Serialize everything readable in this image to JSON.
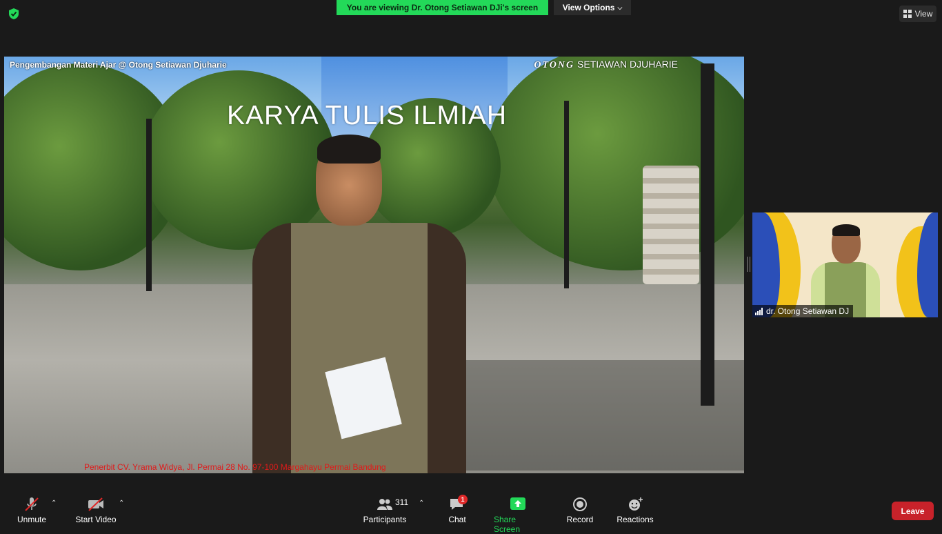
{
  "header": {
    "banner_text": "You are viewing Dr. Otong Setiawan DJi's screen",
    "view_options_label": "View Options",
    "view_label": "View",
    "security_icon": "shield-check-icon"
  },
  "shared_screen": {
    "header_text": "Pengembangan Materi Ajar  @ Otong Setiawan Djuharie",
    "brand_name": "OTONG",
    "brand_surname": "SETIAWAN DJUHARIE",
    "title": "KARYA TULIS ILMIAH",
    "footer_text": "Penerbit CV. Yrama Widya, Jl. Permai 28 No. 97-100 Margahayu Permai Bandung"
  },
  "participant_tile": {
    "name": "dr. Otong Setiawan DJ"
  },
  "toolbar": {
    "unmute_label": "Unmute",
    "start_video_label": "Start Video",
    "participants_label": "Participants",
    "participants_count": "311",
    "chat_label": "Chat",
    "chat_badge": "1",
    "share_screen_label": "Share Screen",
    "record_label": "Record",
    "reactions_label": "Reactions",
    "leave_label": "Leave"
  },
  "colors": {
    "banner": "#23d959",
    "leave": "#c8222a",
    "footer_text": "#e01a1a",
    "background": "#1a1a1a"
  }
}
